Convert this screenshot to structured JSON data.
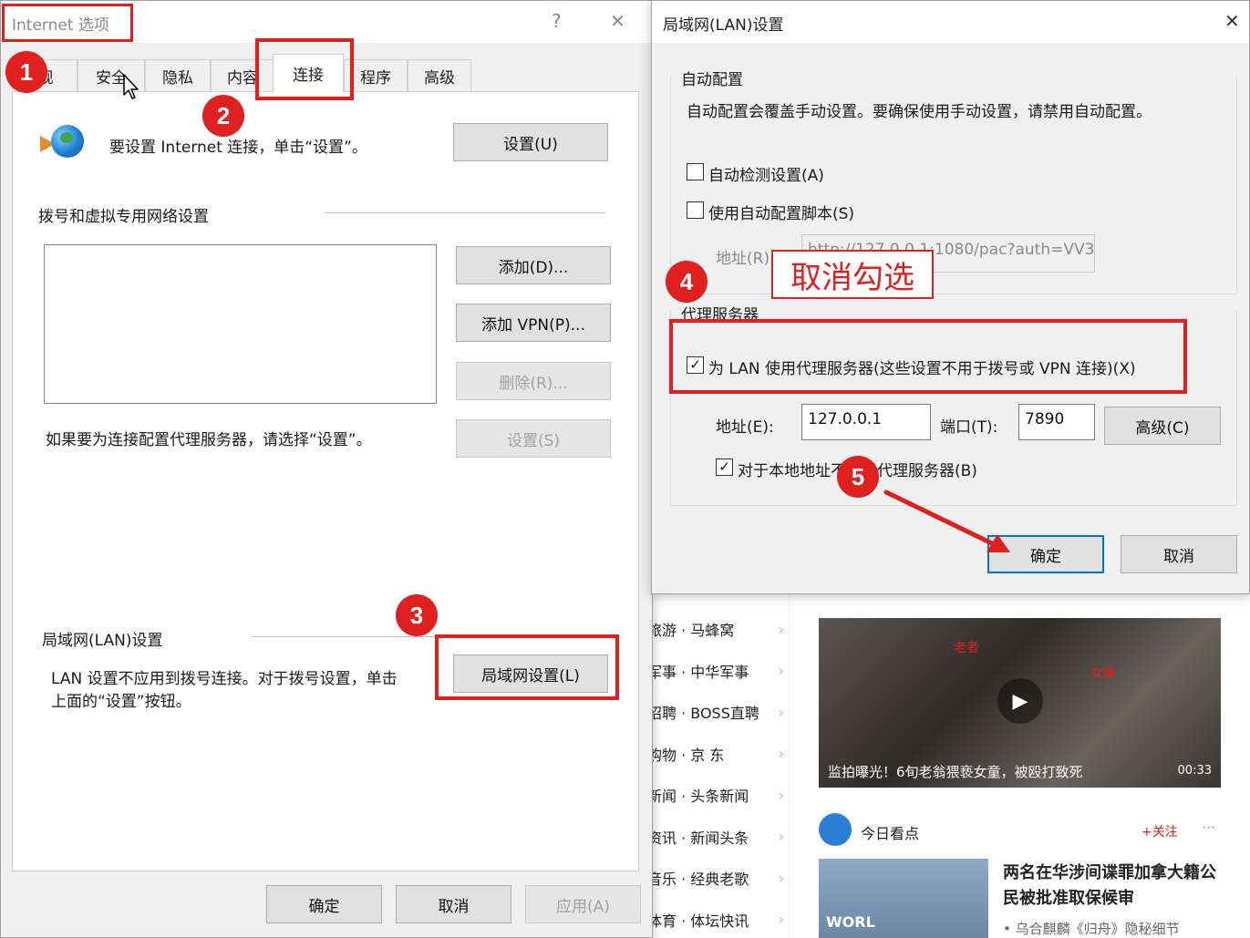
{
  "background_page": {
    "links": [
      {
        "text": "旅游 · 马蜂窝"
      },
      {
        "text": "军事 · 中华军事"
      },
      {
        "text": "招聘 · BOSS直聘"
      },
      {
        "text": "购物 · 京 东"
      },
      {
        "text": "新闻 · 头条新闻"
      },
      {
        "text": "资讯 · 新闻头条"
      },
      {
        "text": "音乐 · 经典老歌"
      },
      {
        "text": "体育 · 体坛快讯"
      }
    ],
    "video": {
      "caption": "监拍曝光！6旬老翁猥亵女童，被殴打致死",
      "duration": "00:33",
      "overlay_left": "老者",
      "overlay_right": "女童"
    },
    "news_source": "今日看点",
    "follow_label": "+关注",
    "more_glyph": "···",
    "headline": "两名在华涉间谍罪加拿大籍公民被批准取保候审",
    "sub_headline": "• 乌合麒麟《归舟》隐秘细节",
    "thumb_text": "WORL"
  },
  "internet_options": {
    "title": "Internet 选项",
    "help_glyph": "?",
    "close_glyph": "✕",
    "tabs": [
      {
        "label": "规"
      },
      {
        "label": "安全"
      },
      {
        "label": "隐私"
      },
      {
        "label": "内容"
      },
      {
        "label": "连接"
      },
      {
        "label": "程序"
      },
      {
        "label": "高级"
      }
    ],
    "setup_text": "要设置 Internet 连接，单击“设置”。",
    "setup_button": "设置(U)",
    "dialup_group": "拨号和虚拟专用网络设置",
    "add_button": "添加(D)...",
    "add_vpn_button": "添加 VPN(P)...",
    "delete_button": "删除(R)...",
    "settings_button": "设置(S)",
    "proxy_hint": "如果要为连接配置代理服务器，请选择“设置”。",
    "lan_group": "局域网(LAN)设置",
    "lan_desc_line1": "LAN 设置不应用到拨号连接。对于拨号设置，单击",
    "lan_desc_line2": "上面的“设置”按钮。",
    "lan_button": "局域网设置(L)",
    "ok_button": "确定",
    "cancel_button": "取消",
    "apply_button": "应用(A)"
  },
  "lan_dialog": {
    "title": "局域网(LAN)设置",
    "close_glyph": "✕",
    "auto_group": "自动配置",
    "auto_desc": "自动配置会覆盖手动设置。要确保使用手动设置，请禁用自动配置。",
    "auto_detect": {
      "label": "自动检测设置(A)",
      "checked": false
    },
    "auto_script": {
      "label": "使用自动配置脚本(S)",
      "checked": false
    },
    "address_label": "地址(R)",
    "script_url": "http://127.0.0.1:1080/pac?auth=VV3",
    "proxy_group": "代理服务器",
    "use_proxy": {
      "label": "为 LAN 使用代理服务器(这些设置不用于拨号或 VPN 连接)(X)",
      "checked": true
    },
    "proxy_address_label": "地址(E):",
    "proxy_address": "127.0.0.1",
    "port_label": "端口(T):",
    "port": "7890",
    "advanced_button": "高级(C)",
    "bypass_local": {
      "label": "对于本地地址不使用代理服务器(B)",
      "checked": true
    },
    "ok_button": "确定",
    "cancel_button": "取消"
  },
  "annotations": {
    "steps": [
      "1",
      "2",
      "3",
      "4",
      "5"
    ],
    "callout": "取消勾选",
    "accent": "#e0201e"
  },
  "check_glyph": "✓",
  "play_glyph": "▶",
  "chevron_glyph": "›"
}
